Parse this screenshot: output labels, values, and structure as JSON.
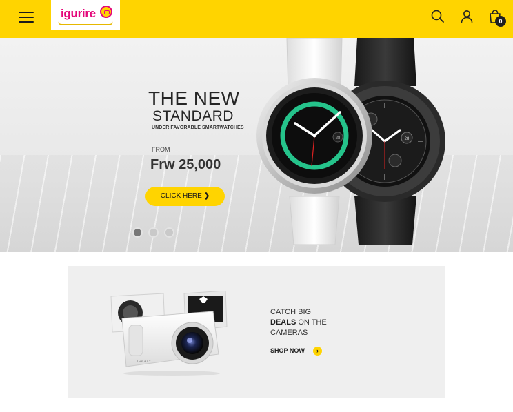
{
  "header": {
    "logo_text": "igurire",
    "cart_count": "0",
    "icons": [
      "menu-icon",
      "search-icon",
      "user-icon",
      "shopping-bag-icon"
    ],
    "brand_color": "#ffd400",
    "logo_color": "#e4087a"
  },
  "hero": {
    "title_line1": "THE NEW",
    "title_line2": "STANDARD",
    "subtitle": "UNDER FAVORABLE SMARTWATCHES",
    "from_label": "FROM",
    "price": "Frw 25,000",
    "cta_label": "CLICK HERE",
    "cta_icon": "chevron-right-icon",
    "slide_count": 3,
    "active_slide": 1,
    "watch_date_1": "28",
    "watch_date_2": "28"
  },
  "promo": {
    "line1": "CATCH BIG",
    "line2_bold": "DEALS",
    "line2_rest": " ON THE",
    "line3": "CAMERAS",
    "shop_label": "SHOP NOW",
    "shop_icon": "chevron-right-icon"
  }
}
